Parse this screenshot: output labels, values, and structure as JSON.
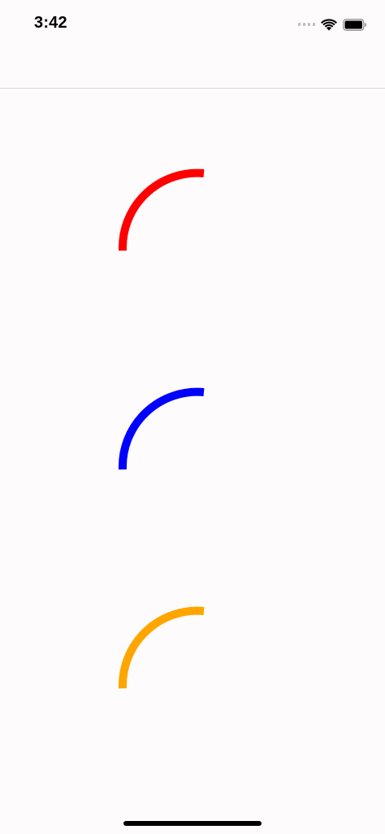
{
  "status_bar": {
    "time": "3:42",
    "icons": [
      "cellular-signal-icon",
      "wifi-icon",
      "battery-icon"
    ]
  },
  "spinners": [
    {
      "name": "red",
      "color": "#ff0000"
    },
    {
      "name": "blue",
      "color": "#0000ff"
    },
    {
      "name": "orange",
      "color": "#ffa500"
    }
  ]
}
